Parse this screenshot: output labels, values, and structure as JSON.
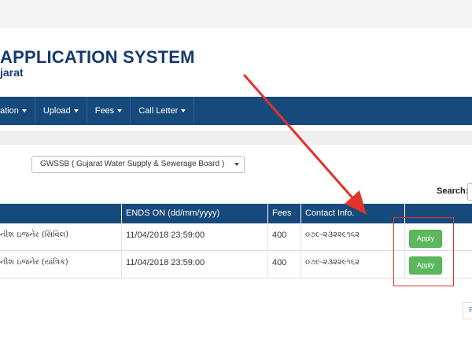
{
  "header": {
    "title": "APPLICATION SYSTEM",
    "subtitle": "jarat"
  },
  "nav": {
    "items": [
      {
        "label": "ation",
        "has_caret": true
      },
      {
        "label": "Upload",
        "has_caret": true
      },
      {
        "label": "Fees",
        "has_caret": true
      },
      {
        "label": "Call Letter",
        "has_caret": true
      }
    ]
  },
  "filter": {
    "board_select_value": "GWSSB ( Gujarat Water Supply & Sewerage Board )"
  },
  "search": {
    "label": "Search:"
  },
  "table": {
    "columns": [
      "ENDS ON (dd/mm/yyyy)",
      "Fees",
      "Contact Info."
    ],
    "rows": [
      {
        "post": "નીશ ઇજનેર (સિવિલ)",
        "ends_on": "11/04/2018 23:59:00",
        "fees": "400",
        "contact": "૦૭૯-૨૩૨૨૯૧૬૨",
        "action": "Apply"
      },
      {
        "post": "નીશ ઇજનેર (યાંત્રિક)",
        "ends_on": "11/04/2018 23:59:00",
        "fees": "400",
        "contact": "૦૭૯-૨૩૨૨૯૧૬૨",
        "action": "Apply"
      }
    ]
  },
  "pagination": {
    "partial_label": "F"
  },
  "colors": {
    "navbar": "#174a7c",
    "title_text": "#163a6e",
    "apply_button": "#5cb85c",
    "annotation": "#e0332a"
  },
  "icons": [
    "dropdown-caret-icon",
    "red-arrow-annotation"
  ]
}
